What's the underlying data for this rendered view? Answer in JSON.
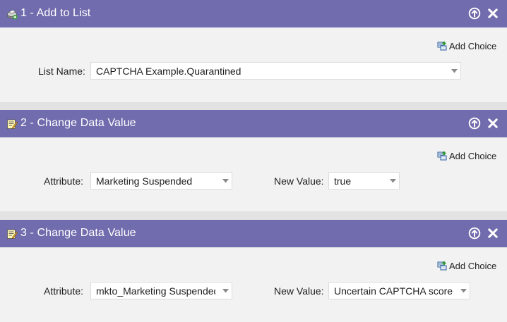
{
  "steps": [
    {
      "title": "1 - Add to List",
      "icon": "add-to-list-icon",
      "add_choice": "Add Choice",
      "fields": [
        {
          "label": "List Name:",
          "value": "CAPTCHA Example.Quarantined"
        }
      ]
    },
    {
      "title": "2 - Change Data Value",
      "icon": "change-data-value-icon",
      "add_choice": "Add Choice",
      "fields": [
        {
          "label": "Attribute:",
          "value": "Marketing Suspended"
        },
        {
          "label": "New Value:",
          "value": "true"
        }
      ]
    },
    {
      "title": "3 - Change Data Value",
      "icon": "change-data-value-icon",
      "add_choice": "Add Choice",
      "fields": [
        {
          "label": "Attribute:",
          "value": "mkto_Marketing Suspended"
        },
        {
          "label": "New Value:",
          "value": "Uncertain CAPTCHA score"
        }
      ]
    }
  ],
  "icons": {
    "move_up": "arrow-up-circle-icon",
    "remove": "close-x-icon",
    "add_choice": "add-choice-icon",
    "dropdown": "chevron-down-icon"
  },
  "colors": {
    "header_bg": "#716cad",
    "body_bg": "#f2f2f2",
    "separator": "#e3e3e3"
  }
}
